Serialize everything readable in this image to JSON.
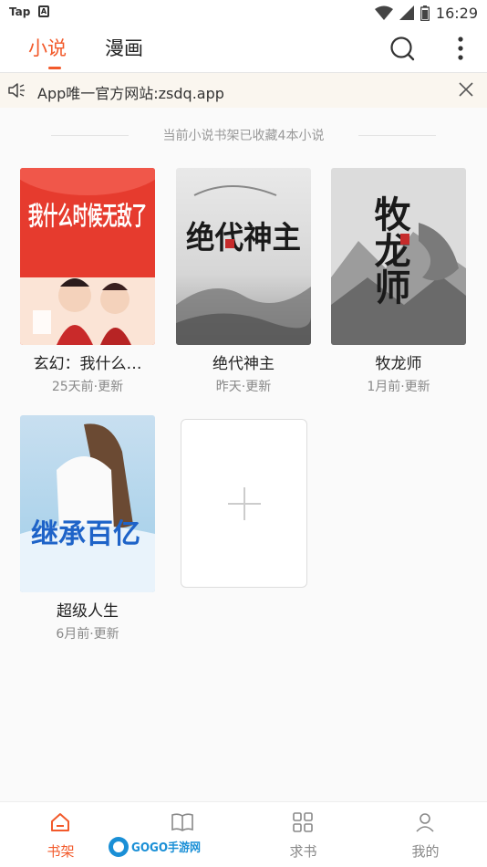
{
  "status_bar": {
    "carrier": "Tap",
    "app_badge": "A",
    "time": "16:29"
  },
  "top_tabs": [
    {
      "label": "小说",
      "active": true
    },
    {
      "label": "漫画",
      "active": false
    }
  ],
  "top_icons": {
    "search": "search-icon",
    "more": "more-vertical-icon"
  },
  "notice": {
    "text": "App唯一官方网站:zsdq.app",
    "icon": "speaker-icon",
    "close_icon": "close-icon"
  },
  "shelf": {
    "summary": "当前小说书架已收藏4本小说",
    "books": [
      {
        "title": "玄幻：我什么…",
        "update": "25天前·更新",
        "cover_text": "我什么时候无敌了"
      },
      {
        "title": "绝代神主",
        "update": "昨天·更新",
        "cover_text": "绝代神主"
      },
      {
        "title": "牧龙师",
        "update": "1月前·更新",
        "cover_text": "牧龙师"
      },
      {
        "title": "超级人生",
        "update": "6月前·更新",
        "cover_text": "继承百亿"
      }
    ],
    "add_icon": "plus-icon"
  },
  "bottom_nav": [
    {
      "label": "书架",
      "icon": "home-icon",
      "active": true
    },
    {
      "label": "",
      "icon": "book-icon",
      "active": false
    },
    {
      "label": "求书",
      "icon": "grid-icon",
      "active": false
    },
    {
      "label": "我的",
      "icon": "user-icon",
      "active": false
    }
  ],
  "watermark": {
    "text": "GOGO手游网"
  },
  "colors": {
    "accent": "#f25a2b",
    "notice_bg": "#faf6ef"
  }
}
